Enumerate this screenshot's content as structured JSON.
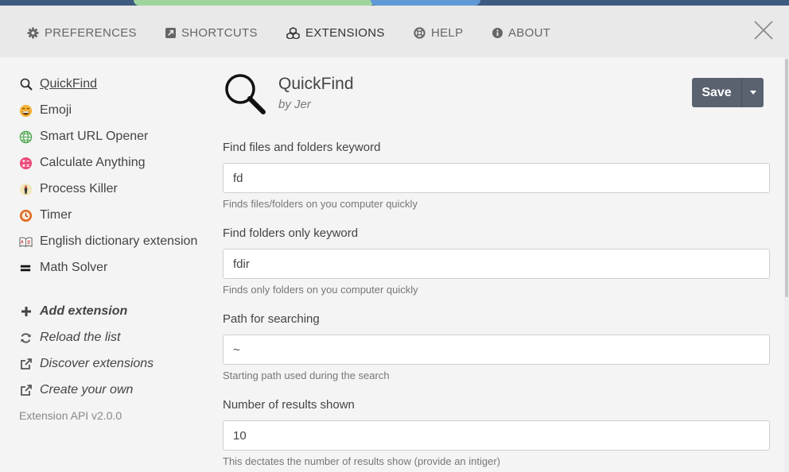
{
  "colors": {
    "strip": "#3e5a80",
    "strip_green": "#9fd59d",
    "strip_blue": "#5f9ad6",
    "save_button": "#5a6270"
  },
  "header": {
    "tabs": [
      {
        "label": "PREFERENCES",
        "icon": "gear-icon"
      },
      {
        "label": "SHORTCUTS",
        "icon": "external-link-square-icon"
      },
      {
        "label": "EXTENSIONS",
        "icon": "cubes-icon",
        "active": true
      },
      {
        "label": "HELP",
        "icon": "life-ring-icon"
      },
      {
        "label": "ABOUT",
        "icon": "info-circle-icon"
      }
    ],
    "close_icon": "close-icon"
  },
  "sidebar": {
    "extensions": [
      {
        "label": "QuickFind",
        "icon": "magnifier-icon",
        "active": true
      },
      {
        "label": "Emoji",
        "icon": "emoji-icon"
      },
      {
        "label": "Smart URL Opener",
        "icon": "globe-icon"
      },
      {
        "label": "Calculate Anything",
        "icon": "calculator-icon"
      },
      {
        "label": "Process Killer",
        "icon": "process-killer-icon"
      },
      {
        "label": "Timer",
        "icon": "timer-icon"
      },
      {
        "label": "English dictionary extension",
        "icon": "dictionary-icon"
      },
      {
        "label": "Math Solver",
        "icon": "math-solver-icon"
      }
    ],
    "actions": [
      {
        "label": "Add extension",
        "icon": "plus-icon"
      },
      {
        "label": "Reload the list",
        "icon": "refresh-icon"
      },
      {
        "label": "Discover extensions",
        "icon": "external-link-icon"
      },
      {
        "label": "Create your own",
        "icon": "external-link-icon"
      }
    ],
    "api_version": "Extension API v2.0.0"
  },
  "main": {
    "name": "QuickFind",
    "author": "by Jer",
    "icon": "magnifier-icon",
    "save_label": "Save",
    "fields": [
      {
        "label": "Find files and folders keyword",
        "value": "fd",
        "help": "Finds files/folders on you computer quickly"
      },
      {
        "label": "Find folders only keyword",
        "value": "fdir",
        "help": "Finds only folders on you computer quickly"
      },
      {
        "label": "Path for searching",
        "value": "~",
        "help": "Starting path used during the search"
      },
      {
        "label": "Number of results shown",
        "value": "10",
        "help": "This dectates the number of results show (provide an intiger)"
      }
    ]
  }
}
